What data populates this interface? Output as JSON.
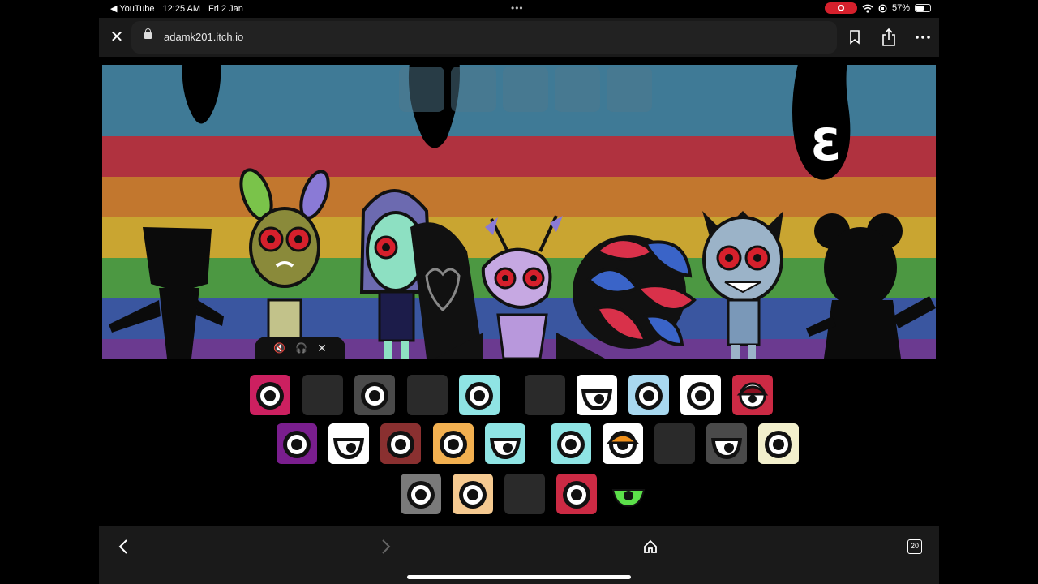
{
  "status_bar": {
    "back_app": "◀ YouTube",
    "time": "12:25 AM",
    "date": "Fri 2 Jan",
    "dots": "•••",
    "battery_text": "57%",
    "battery_level": 0.57,
    "record_color": "#d6202c"
  },
  "browser": {
    "url": "adamk201.itch.io"
  },
  "game": {
    "badge_glyph": "3",
    "stripe_colors": [
      "#3f7a96",
      "#b0323f",
      "#c2772e",
      "#c9a531",
      "#4c9842",
      "#3a56a0",
      "#6b3a90"
    ],
    "characters": [
      {
        "name": "silhouette-left",
        "color": "#0b0b0b"
      },
      {
        "name": "green-ear-bunny",
        "color": "#8a8a3a"
      },
      {
        "name": "hooded-mint-girl",
        "color": "#8de0c2"
      },
      {
        "name": "shadow-heart",
        "color": "#111111"
      },
      {
        "name": "antenna-bug",
        "color": "#c6a8e2"
      },
      {
        "name": "red-blue-swirl",
        "color": "#d9314a"
      },
      {
        "name": "grinning-kid",
        "color": "#9bb3c8"
      },
      {
        "name": "silhouette-mouse",
        "color": "#0b0b0b"
      }
    ],
    "controls": {
      "mute": "🔇",
      "headphones": "🎧",
      "close": "✕"
    }
  },
  "sound_icons": {
    "rows": [
      [
        {
          "bg": "#cc2060",
          "eye": "round",
          "empty": false
        },
        {
          "bg": "#2a2a2a",
          "eye": "none",
          "empty": true
        },
        {
          "bg": "#4a4a4a",
          "eye": "round",
          "empty": false
        },
        {
          "bg": "#2a2a2a",
          "eye": "none",
          "empty": true
        },
        {
          "bg": "#8fe4e4",
          "eye": "round",
          "empty": false
        },
        {
          "bg": "#2a2a2a",
          "eye": "none",
          "empty": true
        },
        {
          "bg": "#ffffff",
          "eye": "half",
          "empty": false
        },
        {
          "bg": "#a8d8ef",
          "eye": "round",
          "empty": false
        },
        {
          "bg": "#ffffff",
          "eye": "round",
          "empty": false
        },
        {
          "bg": "#cc2a44",
          "eye": "lid",
          "empty": false
        }
      ],
      [
        {
          "bg": "#7a1e8e",
          "eye": "round",
          "empty": false
        },
        {
          "bg": "#ffffff",
          "eye": "half",
          "empty": false
        },
        {
          "bg": "#8a3030",
          "eye": "round",
          "empty": false
        },
        {
          "bg": "#f2b050",
          "eye": "round",
          "empty": false
        },
        {
          "bg": "#8fe4e4",
          "eye": "half",
          "empty": false
        },
        {
          "bg": "#8fe4e4",
          "eye": "round",
          "empty": false
        },
        {
          "bg": "#ffffff",
          "eye": "helmet",
          "empty": false
        },
        {
          "bg": "#2a2a2a",
          "eye": "none",
          "empty": true
        },
        {
          "bg": "#4a4a4a",
          "eye": "half",
          "empty": false
        },
        {
          "bg": "#f2efcc",
          "eye": "round",
          "empty": false
        }
      ],
      [
        {
          "bg": "#7a7a7a",
          "eye": "round",
          "empty": false
        },
        {
          "bg": "#f5c990",
          "eye": "round",
          "empty": false
        },
        {
          "bg": "#2a2a2a",
          "eye": "none",
          "empty": true
        },
        {
          "bg": "#cc2a44",
          "eye": "round",
          "empty": false
        },
        {
          "bg": "#000000",
          "eye": "green",
          "empty": false
        }
      ]
    ]
  },
  "bottom_bar": {
    "tabs_count": "20"
  }
}
